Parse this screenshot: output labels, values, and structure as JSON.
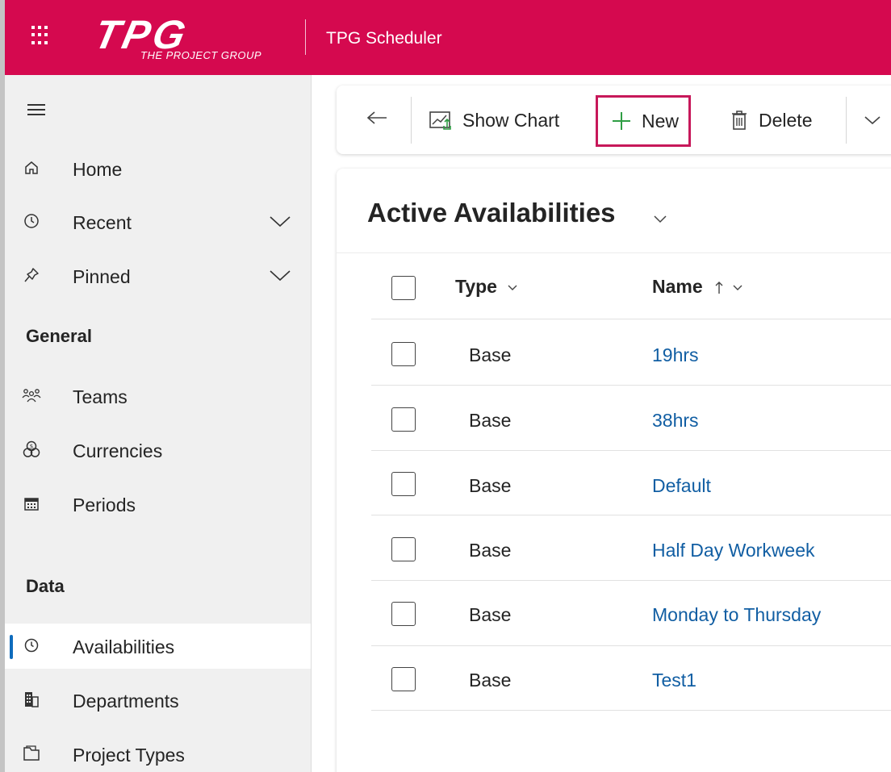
{
  "app": {
    "logo_text": "TPG",
    "logo_subtitle": "THE PROJECT GROUP",
    "title": "TPG Scheduler"
  },
  "sidebar": {
    "top_items": [
      {
        "label": "Home",
        "icon": "home-icon"
      },
      {
        "label": "Recent",
        "icon": "clock-icon",
        "expandable": true
      },
      {
        "label": "Pinned",
        "icon": "pin-icon",
        "expandable": true
      }
    ],
    "sections": [
      {
        "title": "General",
        "items": [
          {
            "label": "Teams",
            "icon": "people-icon"
          },
          {
            "label": "Currencies",
            "icon": "currency-icon"
          },
          {
            "label": "Periods",
            "icon": "calendar-icon"
          }
        ]
      },
      {
        "title": "Data",
        "items": [
          {
            "label": "Availabilities",
            "icon": "clock-icon",
            "selected": true
          },
          {
            "label": "Departments",
            "icon": "building-icon"
          },
          {
            "label": "Project Types",
            "icon": "folder-icon"
          }
        ]
      }
    ]
  },
  "toolbar": {
    "show_chart_label": "Show Chart",
    "new_label": "New",
    "delete_label": "Delete"
  },
  "view": {
    "title": "Active Availabilities",
    "columns": {
      "type": "Type",
      "name": "Name"
    },
    "rows": [
      {
        "type": "Base",
        "name": "19hrs"
      },
      {
        "type": "Base",
        "name": "38hrs"
      },
      {
        "type": "Base",
        "name": "Default"
      },
      {
        "type": "Base",
        "name": "Half Day Workweek"
      },
      {
        "type": "Base",
        "name": "Monday to Thursday"
      },
      {
        "type": "Base",
        "name": "Test1"
      }
    ]
  },
  "colors": {
    "brand": "#d5094f",
    "link": "#115ea3",
    "selection_bar": "#0f6cbd",
    "highlight_border": "#c7185a"
  }
}
